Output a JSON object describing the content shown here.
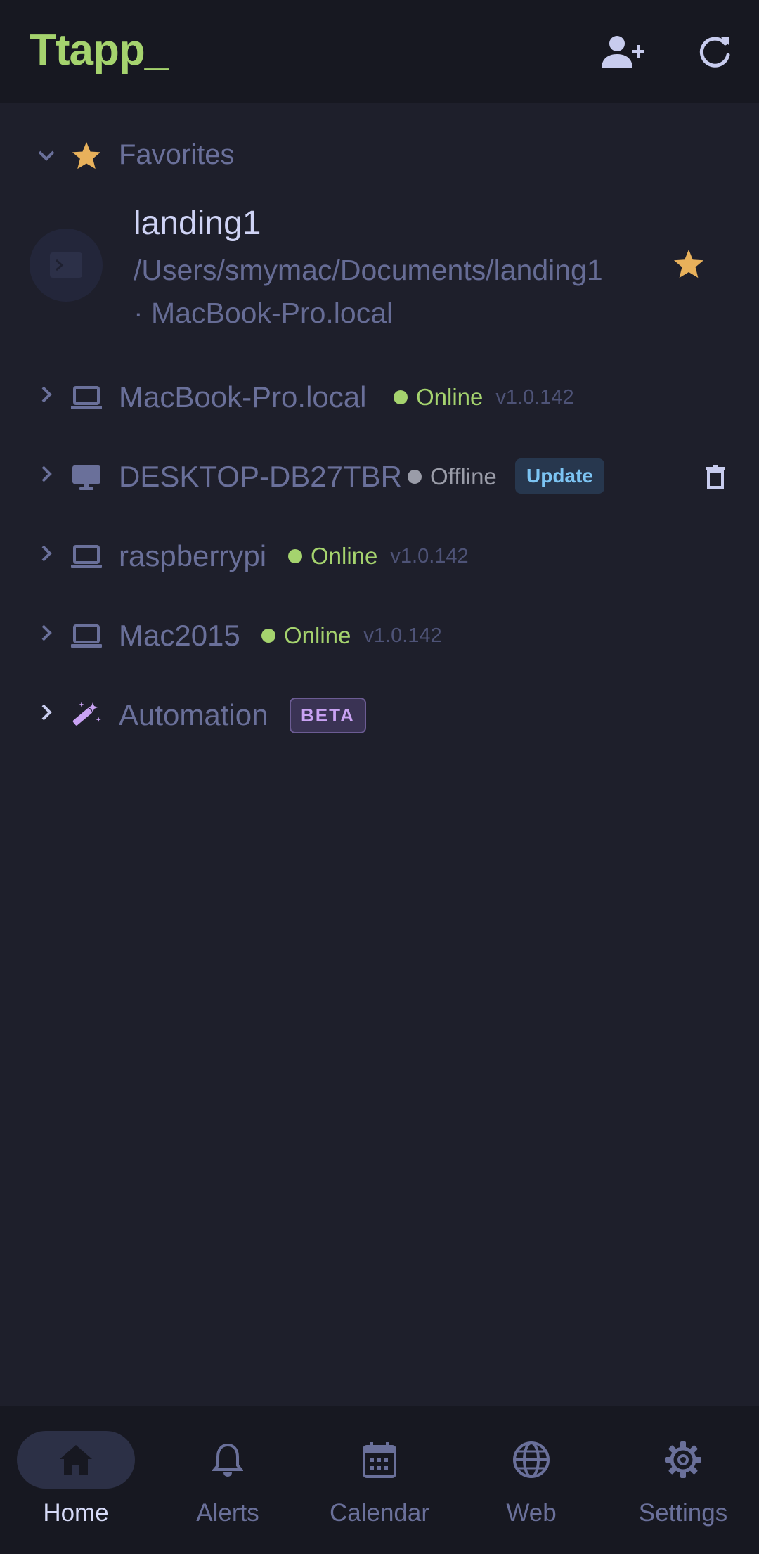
{
  "app": {
    "title": "Ttapp_"
  },
  "header": {
    "add_user_icon": "person-add-icon",
    "refresh_icon": "refresh-icon"
  },
  "favorites": {
    "label": "Favorites",
    "item": {
      "name": "landing1",
      "path": "/Users/smymac/Documents/landing1 · MacBook-Pro.local"
    }
  },
  "devices": [
    {
      "name": "MacBook-Pro.local",
      "type": "laptop",
      "status": "Online",
      "version": "v1.0.142"
    },
    {
      "name": "DESKTOP-DB27TBR",
      "type": "desktop",
      "status": "Offline",
      "badge": "Update"
    },
    {
      "name": "raspberrypi",
      "type": "laptop",
      "status": "Online",
      "version": "v1.0.142"
    },
    {
      "name": "Mac2015",
      "type": "laptop",
      "status": "Online",
      "version": "v1.0.142"
    }
  ],
  "automation": {
    "label": "Automation",
    "badge": "BETA"
  },
  "nav": [
    {
      "label": "Home",
      "icon": "home-icon",
      "active": true
    },
    {
      "label": "Alerts",
      "icon": "bell-icon"
    },
    {
      "label": "Calendar",
      "icon": "calendar-icon"
    },
    {
      "label": "Web",
      "icon": "globe-icon"
    },
    {
      "label": "Settings",
      "icon": "gear-icon"
    }
  ],
  "colors": {
    "background": "#1e1f2b",
    "bar": "#171821",
    "accent_green": "#a5d36e",
    "online": "#a5d36e",
    "offline": "#9a9ca8",
    "star": "#e8b15b",
    "beta": "#c9a2f3",
    "update": "#7cc4f3"
  }
}
